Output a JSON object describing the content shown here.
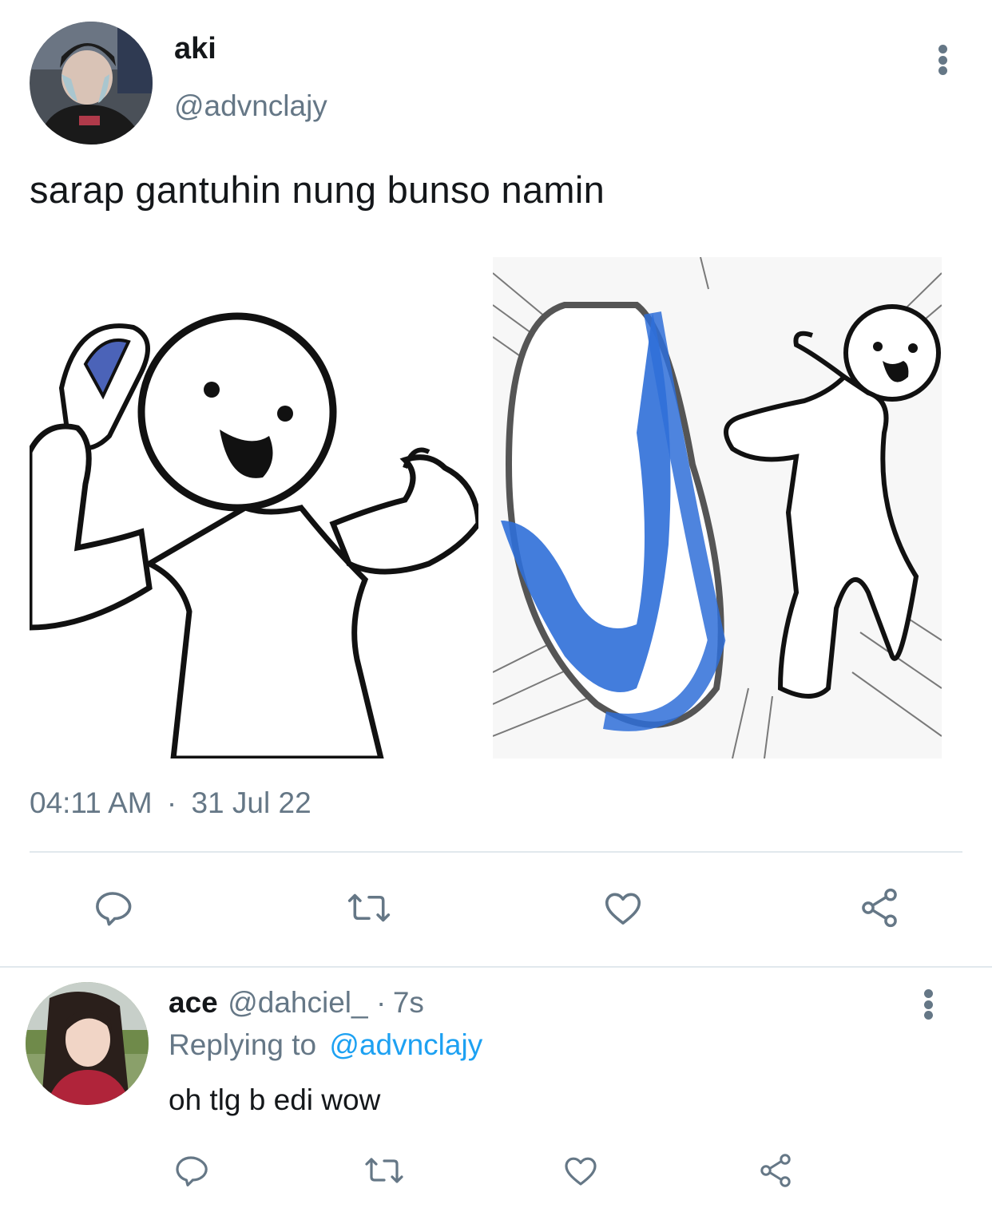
{
  "tweet": {
    "author_name": "aki",
    "author_handle": "@advnclajy",
    "text": "sarap gantuhin nung bunso namin",
    "time": "04:11 AM",
    "separator": "·",
    "date": "31 Jul 22",
    "images": [
      "meme-character-holding-slipper",
      "meme-character-kicking-slipper"
    ],
    "actions": [
      "reply-icon",
      "retweet-icon",
      "like-icon",
      "share-icon"
    ]
  },
  "reply": {
    "author_name": "ace",
    "author_handle": "@dahciel_",
    "separator": "·",
    "time_ago": "7s",
    "replying_to_label": "Replying to",
    "replying_to_handle": "@advnclajy",
    "text": "oh tlg b edi wow",
    "actions": [
      "reply-icon",
      "retweet-icon",
      "like-icon",
      "share-icon"
    ]
  },
  "colors": {
    "primary_text": "#14171a",
    "secondary_text": "#657786",
    "link": "#1da1f2",
    "divider": "#e1e8ed",
    "slipper_blue": "#2f6fd8"
  }
}
